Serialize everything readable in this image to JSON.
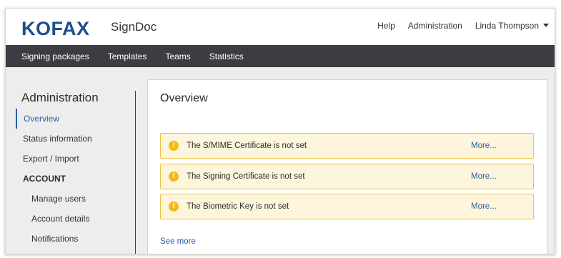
{
  "header": {
    "logo": "KOFAX",
    "product": "SignDoc",
    "links": {
      "help": "Help",
      "administration": "Administration"
    },
    "user": "Linda Thompson"
  },
  "nav": {
    "items": [
      "Signing packages",
      "Templates",
      "Teams",
      "Statistics"
    ]
  },
  "sidebar": {
    "title": "Administration",
    "items": {
      "overview": "Overview",
      "status": "Status information",
      "export": "Export / Import",
      "account_section": "ACCOUNT",
      "manage_users": "Manage users",
      "account_details": "Account details",
      "notifications": "Notifications"
    }
  },
  "main": {
    "title": "Overview",
    "alerts": [
      {
        "text": "The S/MIME Certificate is not set",
        "more": "More..."
      },
      {
        "text": "The Signing Certificate is not set",
        "more": "More..."
      },
      {
        "text": "The Biometric Key is not set",
        "more": "More..."
      }
    ],
    "see_more": "See more"
  },
  "colors": {
    "brand_blue": "#1f4e8c",
    "nav_bg": "#3b3d42",
    "link": "#2b5ea3",
    "alert_bg": "#fdf6dd",
    "alert_border": "#e9c24a",
    "warning_icon": "#f1ba1a"
  }
}
